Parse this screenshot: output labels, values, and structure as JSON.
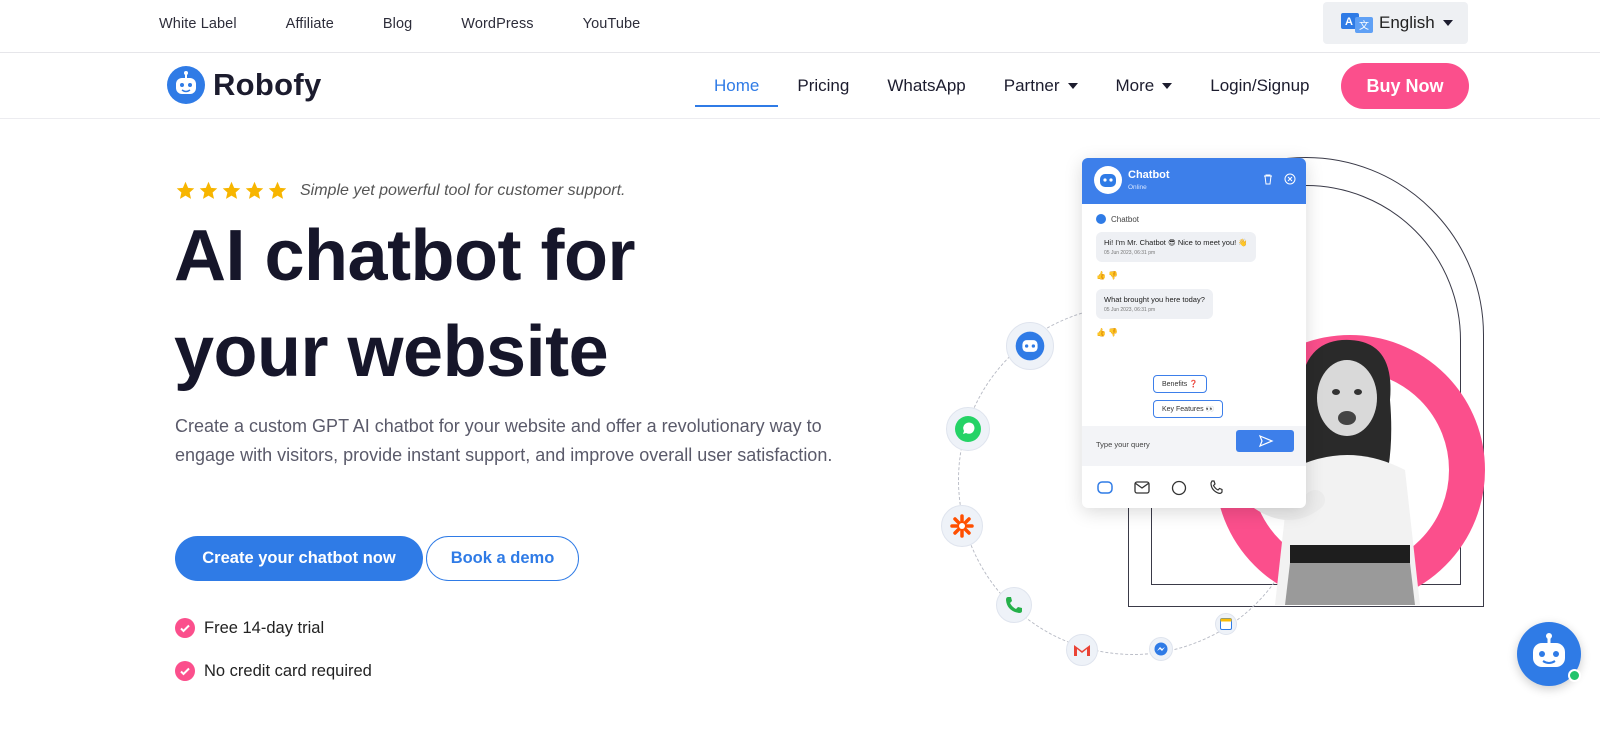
{
  "topbar": {
    "links": [
      "White Label",
      "Affiliate",
      "Blog",
      "WordPress",
      "YouTube"
    ],
    "language": "English"
  },
  "nav": {
    "brand": "Robofy",
    "items": [
      {
        "label": "Home",
        "active": true,
        "dropdown": false
      },
      {
        "label": "Pricing",
        "active": false,
        "dropdown": false
      },
      {
        "label": "WhatsApp",
        "active": false,
        "dropdown": false
      },
      {
        "label": "Partner",
        "active": false,
        "dropdown": true
      },
      {
        "label": "More",
        "active": false,
        "dropdown": true
      },
      {
        "label": "Login/Signup",
        "active": false,
        "dropdown": false
      }
    ],
    "buy_label": "Buy Now"
  },
  "hero": {
    "rating_stars": 5,
    "tagline": "Simple yet powerful tool for customer support.",
    "headline_line1": "AI chatbot for",
    "headline_line2": "your website",
    "description": "Create a custom GPT AI chatbot for your website and offer a revolutionary way to engage with visitors, provide instant support, and improve overall user satisfaction.",
    "cta_primary": "Create your chatbot now",
    "cta_secondary": "Book a demo",
    "features": [
      "Free 14-day trial",
      "No credit card required"
    ]
  },
  "chat_preview": {
    "title": "Chatbot",
    "status": "Online",
    "sender": "Chatbot",
    "messages": [
      {
        "text": "Hi! I'm Mr. Chatbot 😎 Nice to meet you! 👋",
        "time": "05 Jun 2023, 06:31 pm"
      },
      {
        "text": "What brought you here today?",
        "time": "05 Jun 2023, 06:31 pm"
      }
    ],
    "options": [
      "Benefits ❓",
      "Key Features 👀"
    ],
    "input_placeholder": "Type your query"
  },
  "colors": {
    "primary": "#2f7be6",
    "accent_pink": "#fb4f8c",
    "star": "#f7b500",
    "text_dark": "#16162a"
  },
  "icons": [
    "translate-icon",
    "robot-logo-icon",
    "star-icon",
    "check-icon",
    "whatsapp-icon",
    "zapier-icon",
    "phone-icon",
    "gmail-icon",
    "messenger-icon",
    "calendar-icon",
    "send-icon",
    "trash-icon",
    "close-icon"
  ]
}
